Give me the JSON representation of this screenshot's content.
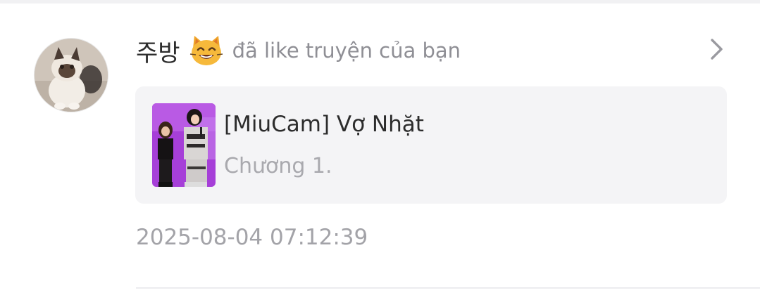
{
  "notification": {
    "username": "주방",
    "emoji_icon": "cat-smiling-face-icon",
    "action_text": "đã like truyện của bạn",
    "timestamp": "2025-08-04 07:12:39",
    "avatar_icon": "cat-avatar-icon",
    "chevron_icon": "chevron-right-icon"
  },
  "story": {
    "title": "[MiuCam] Vợ Nhặt",
    "chapter": "Chương 1.",
    "cover_icon": "story-cover-image"
  },
  "colors": {
    "title_text": "#2c2c2c",
    "muted_text": "#8f8f95",
    "card_background": "#f4f4f6",
    "cover_purple": "#a63fd8"
  }
}
